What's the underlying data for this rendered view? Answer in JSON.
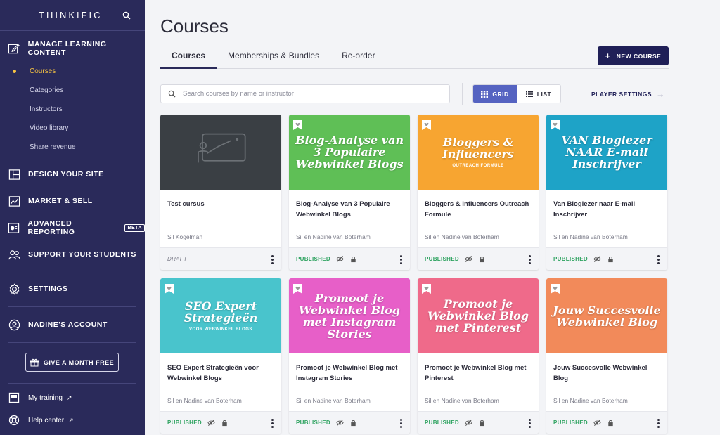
{
  "brand": {
    "name": "THINKIFIC"
  },
  "sidebar": {
    "sections": [
      {
        "label": "MANAGE LEARNING CONTENT",
        "icon": "edit-icon"
      },
      {
        "label": "DESIGN YOUR SITE",
        "icon": "layout-icon"
      },
      {
        "label": "MARKET & SELL",
        "icon": "chart-icon"
      },
      {
        "label": "ADVANCED REPORTING",
        "icon": "report-icon",
        "badge": "BETA"
      },
      {
        "label": "SUPPORT YOUR STUDENTS",
        "icon": "users-icon"
      },
      {
        "label": "SETTINGS",
        "icon": "gear-icon"
      },
      {
        "label": "NADINE'S ACCOUNT",
        "icon": "account-icon"
      }
    ],
    "subitems": [
      {
        "label": "Courses",
        "active": true
      },
      {
        "label": "Categories"
      },
      {
        "label": "Instructors"
      },
      {
        "label": "Video library"
      },
      {
        "label": "Share revenue"
      }
    ],
    "gift_button": "GIVE A MONTH FREE",
    "footer": [
      {
        "label": "My training",
        "icon": "training-icon"
      },
      {
        "label": "Help center",
        "icon": "help-icon"
      }
    ]
  },
  "main": {
    "title": "Courses",
    "tabs": [
      "Courses",
      "Memberships & Bundles",
      "Re-order"
    ],
    "new_course": "NEW COURSE",
    "search_placeholder": "Search courses by name or instructor",
    "view": {
      "grid": "GRID",
      "list": "LIST",
      "active": "grid"
    },
    "player_settings": "PLAYER SETTINGS"
  },
  "courses": [
    {
      "title": "Test cursus",
      "author": "Sil Kogelman",
      "status": "DRAFT",
      "thumb_title": "",
      "thumb_sub": "",
      "bg": "#3a3f44"
    },
    {
      "title": "Blog-Analyse van 3 Populaire Webwinkel Blogs",
      "author": "Sil en Nadine van Boterham",
      "status": "PUBLISHED",
      "thumb_title": "Blog-Analyse van 3 Populaire Webwinkel Blogs",
      "thumb_sub": "",
      "bg": "#5fbf56"
    },
    {
      "title": "Bloggers & Influencers Outreach Formule",
      "author": "Sil en Nadine van Boterham",
      "status": "PUBLISHED",
      "thumb_title": "Bloggers & Influencers",
      "thumb_sub": "OUTREACH FORMULE",
      "bg": "#f7a531"
    },
    {
      "title": "Van Bloglezer naar E-mail Inschrijver",
      "author": "Sil en Nadine van Boterham",
      "status": "PUBLISHED",
      "thumb_title": "VAN Bloglezer NAAR E-mail Inschrijver",
      "thumb_sub": "",
      "bg": "#1ea3c7"
    },
    {
      "title": "SEO Expert Strategieën voor Webwinkel Blogs",
      "author": "Sil en Nadine van Boterham",
      "status": "PUBLISHED",
      "thumb_title": "SEO Expert Strategieën",
      "thumb_sub": "VOOR WEBWINKEL BLOGS",
      "bg": "#49c4cc"
    },
    {
      "title": "Promoot je Webwinkel Blog met Instagram Stories",
      "author": "Sil en Nadine van Boterham",
      "status": "PUBLISHED",
      "thumb_title": "Promoot je Webwinkel Blog met Instagram Stories",
      "thumb_sub": "",
      "bg": "#e75fc8"
    },
    {
      "title": "Promoot je Webwinkel Blog met Pinterest",
      "author": "Sil en Nadine van Boterham",
      "status": "PUBLISHED",
      "thumb_title": "Promoot je Webwinkel Blog met Pinterest",
      "thumb_sub": "",
      "bg": "#ef6a8a"
    },
    {
      "title": "Jouw Succesvolle Webwinkel Blog",
      "author": "Sil en Nadine van Boterham",
      "status": "PUBLISHED",
      "thumb_title": "Jouw Succesvolle Webwinkel Blog",
      "thumb_sub": "",
      "bg": "#f28a5a"
    }
  ],
  "colors": {
    "sidebar": "#2a2a5a",
    "accent": "#5563c1",
    "published": "#2fa361",
    "active_nav": "#f5c242"
  }
}
